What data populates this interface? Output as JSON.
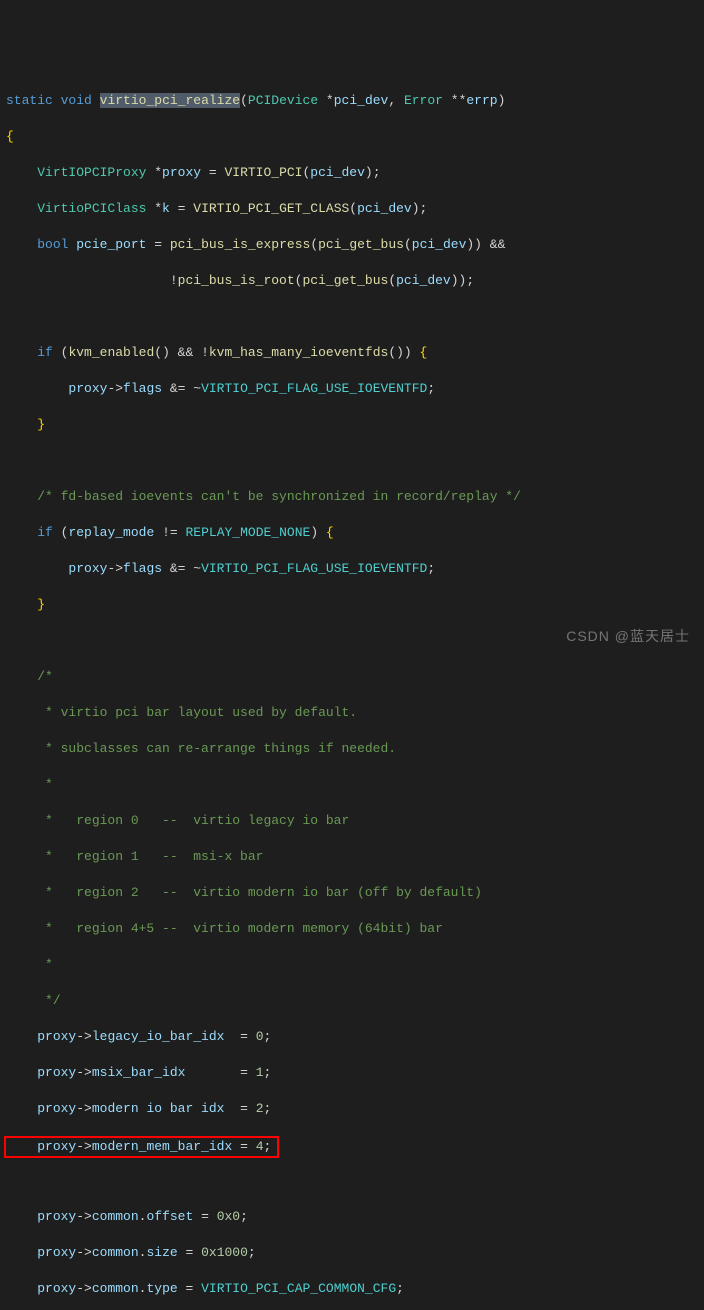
{
  "code": {
    "l1": {
      "static": "static",
      "void": "void",
      "fn": "virtio_pci_realize",
      "type1": "PCIDevice",
      "p1": "pci_dev",
      "type2": "Error",
      "p2": "errp"
    },
    "l2": {
      "brace": "{"
    },
    "l3": {
      "type": "VirtIOPCIProxy",
      "var": "proxy",
      "fn": "VIRTIO_PCI",
      "arg": "pci_dev"
    },
    "l4": {
      "type": "VirtioPCIClass",
      "var": "k",
      "fn": "VIRTIO_PCI_GET_CLASS",
      "arg": "pci_dev"
    },
    "l5": {
      "type": "bool",
      "var": "pcie_port",
      "fn1": "pci_bus_is_express",
      "fn2": "pci_get_bus",
      "arg": "pci_dev"
    },
    "l6": {
      "fn1": "pci_bus_is_root",
      "fn2": "pci_get_bus",
      "arg": "pci_dev"
    },
    "l7": {
      "if": "if",
      "fn1": "kvm_enabled",
      "fn2": "kvm_has_many_ioeventfds"
    },
    "l8": {
      "m1": "proxy",
      "m2": "flags",
      "const": "VIRTIO_PCI_FLAG_USE_IOEVENTFD"
    },
    "l9": {
      "brace": "}"
    },
    "c1": "/* fd-based ioevents can't be synchronized in record/replay */",
    "l10": {
      "if": "if",
      "var": "replay_mode",
      "const": "REPLAY_MODE_NONE"
    },
    "l11": {
      "m1": "proxy",
      "m2": "flags",
      "const": "VIRTIO_PCI_FLAG_USE_IOEVENTFD"
    },
    "l12": {
      "brace": "}"
    },
    "cb0": "/*",
    "cb1": " * virtio pci bar layout used by default.",
    "cb2": " * subclasses can re-arrange things if needed.",
    "cb3": " *",
    "cb4": " *   region 0   --  virtio legacy io bar",
    "cb5": " *   region 1   --  msi-x bar",
    "cb6": " *   region 2   --  virtio modern io bar (off by default)",
    "cb7": " *   region 4+5 --  virtio modern memory (64bit) bar",
    "cb8": " *",
    "cb9": " */",
    "l13": {
      "m1": "proxy",
      "m2": "legacy_io_bar_idx",
      "pad": "  ",
      "val": "0"
    },
    "l14": {
      "m1": "proxy",
      "m2": "msix_bar_idx",
      "pad": "       ",
      "val": "1"
    },
    "l15": {
      "m1": "proxy",
      "m2": "modern io bar idx",
      "pad": "  ",
      "val": "2"
    },
    "l16": {
      "m1": "proxy",
      "m2": "modern_mem_bar_idx",
      "pad": " ",
      "val": "4"
    },
    "l17": {
      "m1": "proxy",
      "m2": "common",
      "m3": "offset",
      "val": "0x0"
    },
    "l18": {
      "m1": "proxy",
      "m2": "common",
      "m3": "size",
      "val": "0x1000"
    },
    "l19": {
      "m1": "proxy",
      "m2": "common",
      "m3": "type",
      "const": "VIRTIO_PCI_CAP_COMMON_CFG"
    }
  },
  "watermark": "CSDN @蓝天居士"
}
